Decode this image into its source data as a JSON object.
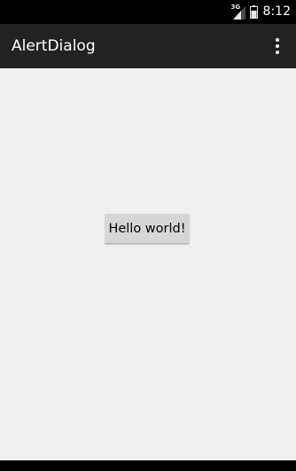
{
  "status_bar": {
    "network_type": "3G",
    "time": "8:12",
    "icons": [
      "signal-icon",
      "battery-icon"
    ]
  },
  "action_bar": {
    "title": "AlertDialog",
    "overflow_icon": "overflow-menu-icon"
  },
  "main": {
    "button_label": "Hello world!"
  },
  "colors": {
    "status_bar": "#000000",
    "action_bar": "#222222",
    "background": "#f0f0f0",
    "button": "#d6d6d6"
  }
}
